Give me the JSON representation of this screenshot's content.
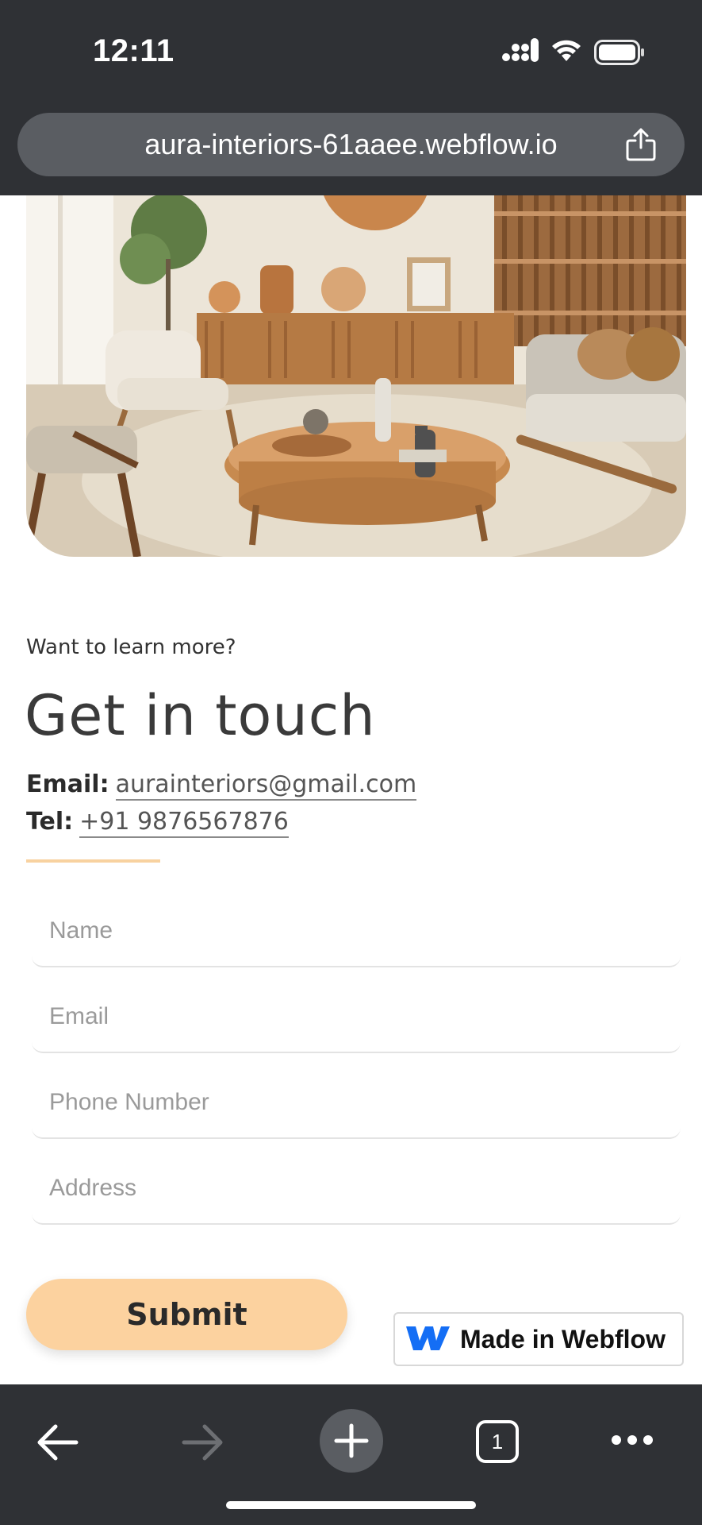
{
  "status_bar": {
    "time": "12:11"
  },
  "browser": {
    "url": "aura-interiors-61aaee.webflow.io",
    "tab_count": "1"
  },
  "hero": {
    "alt": "Living room interior with wooden furniture"
  },
  "contact": {
    "kicker": "Want to learn more?",
    "heading": "Get in touch",
    "email_label": "Email:",
    "email_value": "aurainteriors@gmail.com",
    "tel_label": "Tel:",
    "tel_value": "+91 9876567876"
  },
  "form": {
    "name_placeholder": "Name",
    "email_placeholder": "Email",
    "phone_placeholder": "Phone Number",
    "address_placeholder": "Address",
    "submit_label": "Submit"
  },
  "badge": {
    "label": "Made in Webflow"
  },
  "colors": {
    "accent": "#fcd29f",
    "chrome": "#2f3135",
    "urlbar": "#5a5d62"
  }
}
